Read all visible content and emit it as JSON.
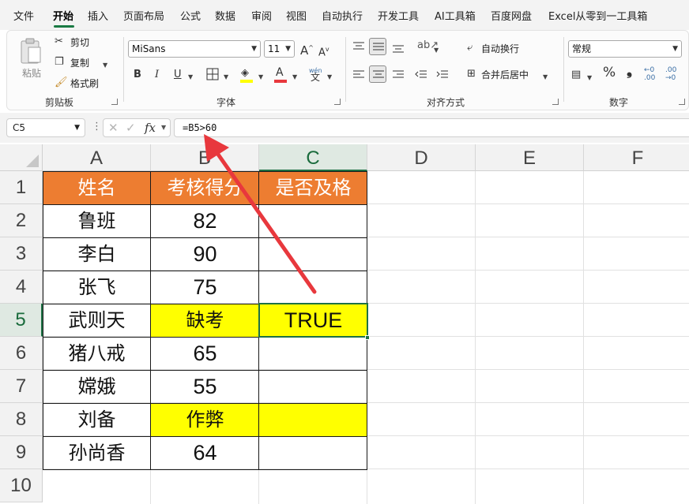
{
  "menu": {
    "items": [
      "文件",
      "开始",
      "插入",
      "页面布局",
      "公式",
      "数据",
      "审阅",
      "视图",
      "自动执行",
      "开发工具",
      "AI工具箱",
      "百度网盘",
      "Excel从零到一工具箱"
    ],
    "active_index": 1
  },
  "ribbon": {
    "clipboard": {
      "paste": "粘贴",
      "cut": "剪切",
      "copy": "复制",
      "format_painter": "格式刷",
      "label": "剪贴板"
    },
    "font": {
      "font_name": "MiSans",
      "font_size": "11",
      "bold": "B",
      "italic": "I",
      "underline": "U",
      "grow": "A",
      "shrink": "A",
      "label": "字体",
      "phonetic_top": "wén",
      "phonetic_bottom": "文"
    },
    "alignment": {
      "wrap_text": "自动换行",
      "merge_center": "合并后居中",
      "label": "对齐方式"
    },
    "number": {
      "format": "常规",
      "percent": "%",
      "comma": "❟",
      "inc_decimal": "←0 .00",
      "dec_decimal": ".00 →0",
      "label": "数字"
    }
  },
  "formula_bar": {
    "name_box": "C5",
    "fx": "fx",
    "formula": "=B5>60"
  },
  "sheet": {
    "columns": [
      "A",
      "B",
      "C",
      "D",
      "E",
      "F"
    ],
    "rows": [
      "1",
      "2",
      "3",
      "4",
      "5",
      "6",
      "7",
      "8",
      "9",
      "10"
    ],
    "selected_cell": "C5",
    "header_fill": "#ed7d31",
    "highlight_fill": "#ffff00",
    "selection_color": "#1e7145",
    "table": {
      "header": [
        "姓名",
        "考核得分",
        "是否及格"
      ],
      "rows": [
        [
          "鲁班",
          "82",
          ""
        ],
        [
          "李白",
          "90",
          ""
        ],
        [
          "张飞",
          "75",
          ""
        ],
        [
          "武则天",
          "缺考",
          "TRUE"
        ],
        [
          "猪八戒",
          "65",
          ""
        ],
        [
          "嫦娥",
          "55",
          ""
        ],
        [
          "刘备",
          "作弊",
          ""
        ],
        [
          "孙尚香",
          "64",
          ""
        ]
      ]
    }
  },
  "annotation": {
    "arrow_color": "#e8383d"
  }
}
